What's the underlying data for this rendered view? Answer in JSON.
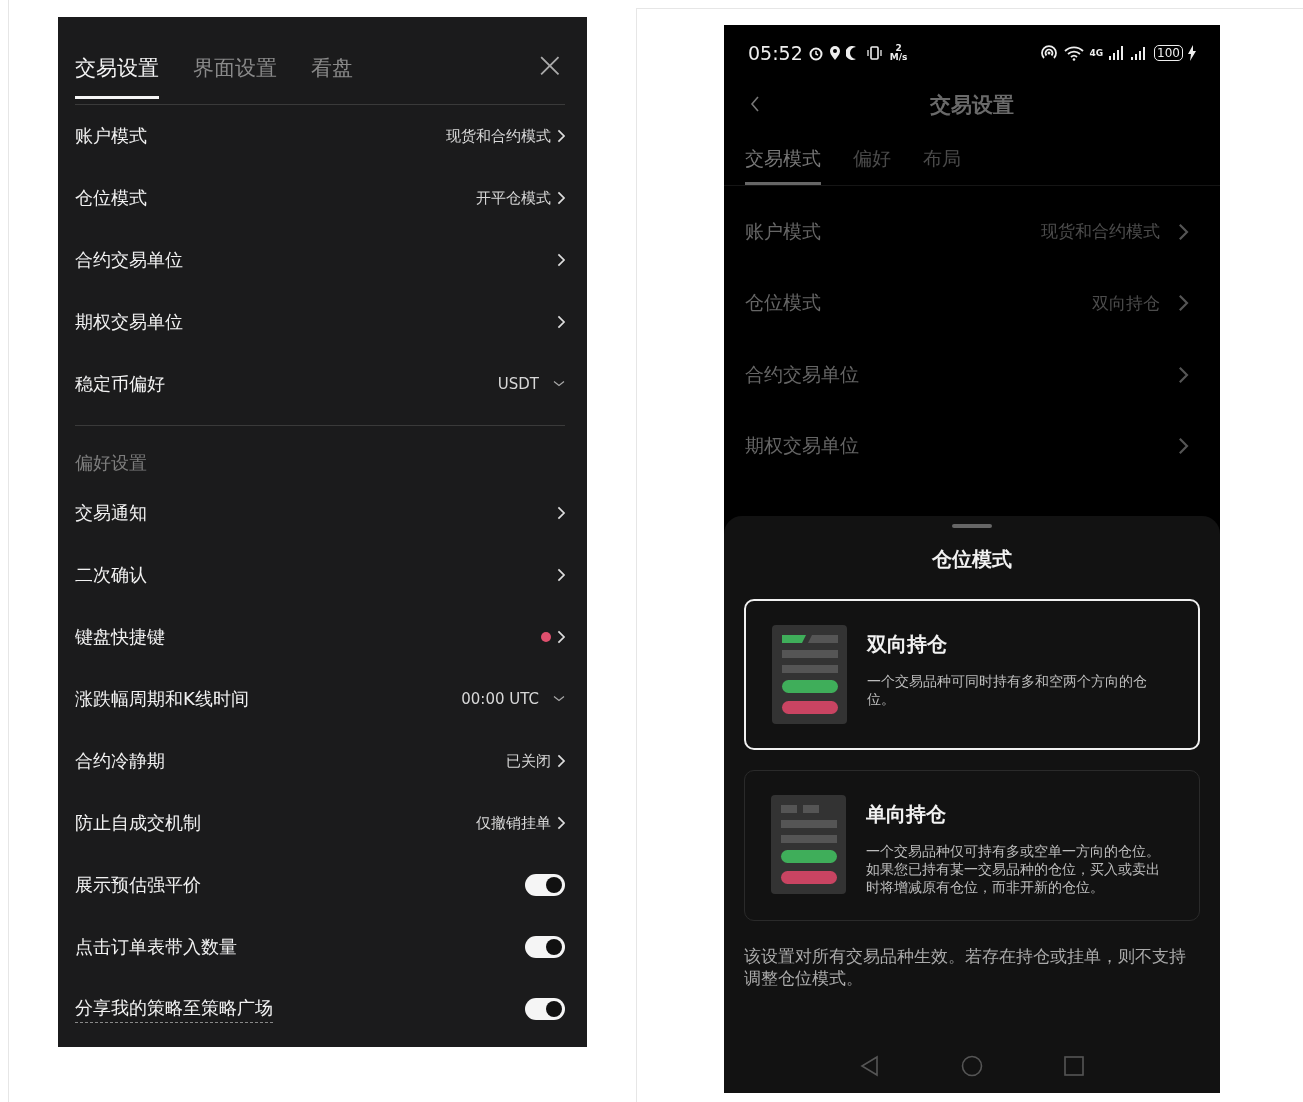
{
  "settings_panel": {
    "tabs": [
      {
        "label": "交易设置",
        "selected": true
      },
      {
        "label": "界面设置",
        "selected": false
      },
      {
        "label": "看盘",
        "selected": false
      }
    ],
    "close": "×",
    "rows": [
      {
        "kind": "link",
        "label": "账户模式",
        "value": "现货和合约模式"
      },
      {
        "kind": "link",
        "label": "仓位模式",
        "value": "开平仓模式"
      },
      {
        "kind": "link",
        "label": "合约交易单位"
      },
      {
        "kind": "link",
        "label": "期权交易单位"
      },
      {
        "kind": "dropdown",
        "label": "稳定币偏好",
        "value": "USDT"
      }
    ],
    "section_title": "偏好设置",
    "preference_rows": [
      {
        "kind": "link",
        "label": "交易通知"
      },
      {
        "kind": "link",
        "label": "二次确认"
      },
      {
        "kind": "dot",
        "label": "键盘快捷键",
        "color": "#e0506e"
      },
      {
        "kind": "dropdown",
        "label": "涨跌幅周期和K线时间",
        "value": "00:00 UTC"
      },
      {
        "kind": "link",
        "label": "合约冷静期",
        "value": "已关闭"
      },
      {
        "kind": "link",
        "label": "防止自成交机制",
        "value": "仅撤销挂单"
      },
      {
        "kind": "toggle",
        "label": "展示预估强平价",
        "on": true
      },
      {
        "kind": "toggle",
        "label": "点击订单表带入数量",
        "on": true
      },
      {
        "kind": "toggle",
        "label": "分享我的策略至策略广场",
        "on": true,
        "underlined": true
      }
    ]
  },
  "phone": {
    "status_bar": {
      "time": "05:52",
      "speed_value": "2",
      "speed_unit": "M/s",
      "network": "4G",
      "battery": "100"
    },
    "title": "交易设置",
    "tabs": [
      {
        "label": "交易模式",
        "selected": true
      },
      {
        "label": "偏好",
        "selected": false
      },
      {
        "label": "布局",
        "selected": false
      }
    ],
    "rows": [
      {
        "label": "账户模式",
        "value": "现货和合约模式"
      },
      {
        "label": "仓位模式",
        "value": "双向持仓"
      },
      {
        "label": "合约交易单位"
      },
      {
        "label": "期权交易单位"
      }
    ],
    "sheet": {
      "title": "仓位模式",
      "options": [
        {
          "kind": "dual",
          "title": "双向持仓",
          "description": "一个交易品种可同时持有多和空两个方向的仓位。",
          "selected": true
        },
        {
          "kind": "single",
          "title": "单向持仓",
          "description": "一个交易品种仅可持有多或空单一方向的仓位。如果您已持有某一交易品种的仓位，买入或卖出时将增减原有仓位，而非开新的仓位。",
          "selected": false
        }
      ],
      "note": "该设置对所有交易品种生效。若存在持仓或挂单，则不支持调整仓位模式。"
    }
  }
}
